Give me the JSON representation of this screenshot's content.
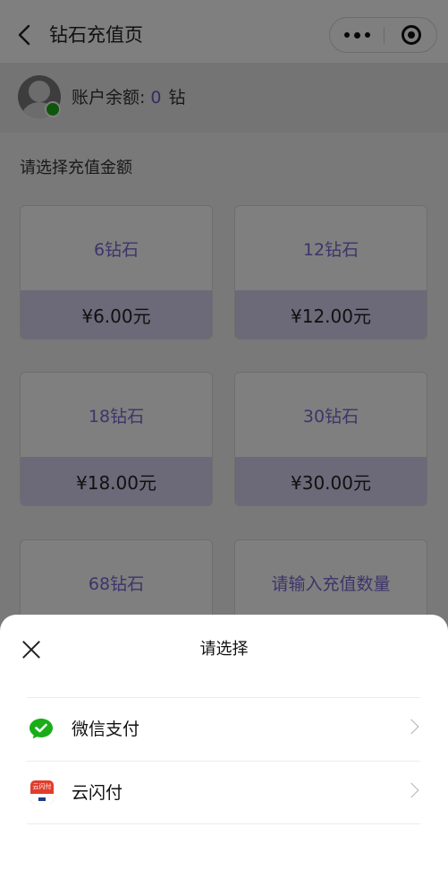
{
  "nav": {
    "title": "钻石充值页"
  },
  "account": {
    "label": "账户余额:",
    "amount": "0",
    "unit": "钻"
  },
  "section": {
    "label": "请选择充值金额"
  },
  "packages": [
    {
      "name": "6钻石",
      "price": "¥6.00元"
    },
    {
      "name": "12钻石",
      "price": "¥12.00元"
    },
    {
      "name": "18钻石",
      "price": "¥18.00元"
    },
    {
      "name": "30钻石",
      "price": "¥30.00元"
    },
    {
      "name": "68钻石"
    },
    {
      "name": "请输入充值数量"
    }
  ],
  "sheet": {
    "title": "请选择",
    "methods": [
      {
        "label": "微信支付",
        "icon": "wechat-pay-icon"
      },
      {
        "label": "云闪付",
        "icon": "unionpay-icon",
        "icon_text": "云闪付"
      }
    ]
  },
  "colors": {
    "accent": "#7c69d4",
    "price_bg": "#d9d3f0",
    "wechat": "#1aad19",
    "unionpay": "#e23d2b"
  }
}
